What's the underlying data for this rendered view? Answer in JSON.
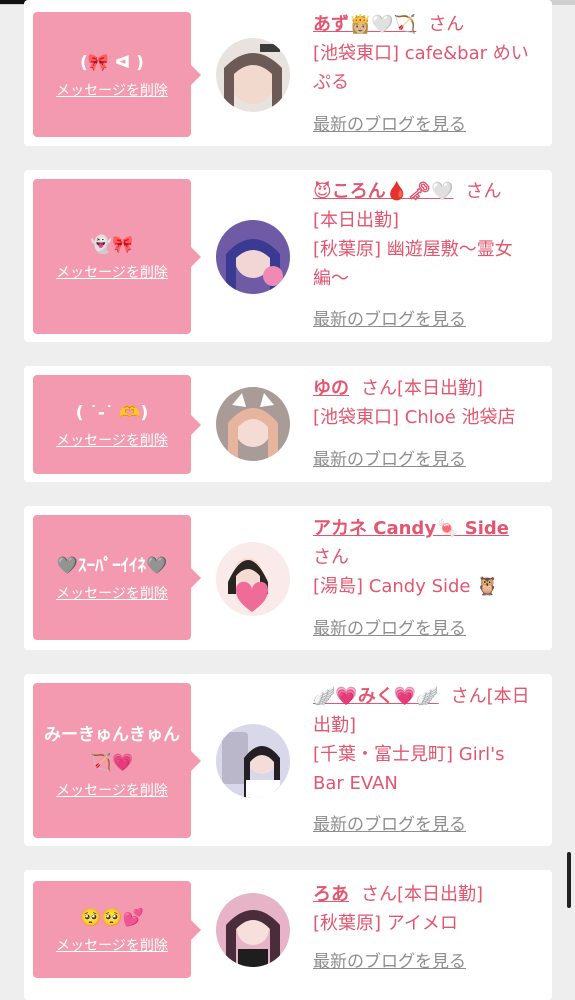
{
  "delete_label": "メッセージを削除",
  "blog_label": "最新のブログを見る",
  "san": "さん",
  "colors": {
    "bubble": "#f49ab0",
    "name": "#e2566f",
    "muted": "#8e8e8e"
  },
  "cards": [
    {
      "message": "(🎀 ᐊ )",
      "name": "あず👸🏼🤍🏹",
      "san": "さん",
      "details": [
        "[池袋東口] cafe&bar めいぷる"
      ]
    },
    {
      "message": "👻🎀",
      "name": "😈ころん🩸🗝🤍",
      "san": "さん",
      "details": [
        "[本日出勤]",
        "[秋葉原] 幽遊屋敷〜霊女編〜"
      ]
    },
    {
      "message": "( ˙-˙ 🫶)",
      "name": "ゆの",
      "san": "さん[本日出勤]",
      "details": [
        "[池袋東口] Chloé 池袋店"
      ]
    },
    {
      "message": "🩶ｽｰﾊﾟｰｲｲﾈ🩶",
      "name": "アカネ Candy🍬 Side",
      "san": "さん",
      "details": [
        "[湯島] Candy Side 🦉"
      ]
    },
    {
      "message": "みーきゅんきゅん🏹💗",
      "name": "🪽💗みく💗🪽",
      "san": "さん[本日出勤]",
      "details": [
        "[千葉・富士見町] Girl's Bar EVAN"
      ]
    },
    {
      "message": "🥺🥺💕",
      "name": "ろあ",
      "san": "さん[本日出勤]",
      "details": [
        "[秋葉原] アイメロ"
      ]
    }
  ]
}
